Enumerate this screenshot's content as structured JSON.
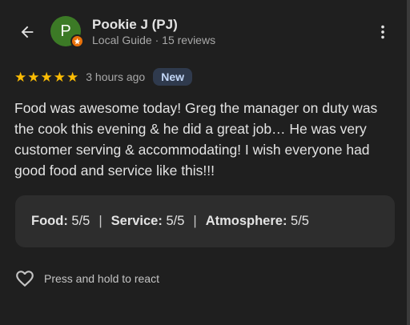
{
  "reviewer": {
    "avatar_letter": "P",
    "name": "Pookie J (PJ)",
    "subline": "Local Guide · 15 reviews"
  },
  "review": {
    "star_rating": 5,
    "time_ago": "3 hours ago",
    "badge": "New",
    "text": "Food was awesome today! Greg the manager on duty was the cook this evening & he did a great job… He was very customer serving & accommodating! I wish everyone had good food and service like this!!!"
  },
  "ratings": {
    "food_label": "Food:",
    "food_value": "5/5",
    "service_label": "Service:",
    "service_value": "5/5",
    "atmosphere_label": "Atmosphere:",
    "atmosphere_value": "5/5",
    "separator": "|"
  },
  "react": {
    "label": "Press and hold to react"
  },
  "icons": {
    "back": "arrow-back-icon",
    "more": "more-vert-icon",
    "star": "star-icon",
    "heart": "heart-outline-icon",
    "local_guide": "local-guide-badge-icon"
  },
  "colors": {
    "background": "#1f1f1f",
    "star": "#fbbc04",
    "avatar": "#3c7a26",
    "local_guide_badge": "#e8710a",
    "ratings_card": "#2d2d2d",
    "new_badge_bg": "#2f3a4d",
    "new_badge_text": "#c3d7f7"
  }
}
